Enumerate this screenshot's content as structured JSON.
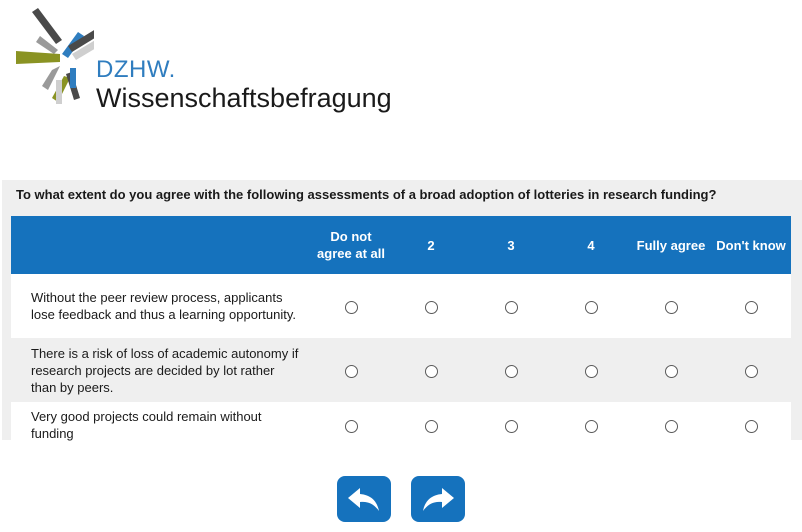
{
  "logo": {
    "short_name": "DZHW.",
    "full_name": "Wissenschaftsbefragung"
  },
  "question": {
    "text": "To what extent do you agree with the following assessments of a broad adoption of lotteries in research funding?",
    "columns": [
      "Do not agree at all",
      "2",
      "3",
      "4",
      "Fully agree",
      "Don't know"
    ],
    "items": [
      "Without the peer review process, applicants lose feedback and thus a learning opportunity.",
      "There is a risk of loss of academic autonomy if research projects are decided by lot rather than by peers.",
      "Very good projects could remain without funding"
    ]
  },
  "navigation": {
    "back_icon": "arrow-back-icon",
    "next_icon": "arrow-forward-icon"
  },
  "colors": {
    "accent": "#1572bd",
    "panel": "#efefef"
  }
}
